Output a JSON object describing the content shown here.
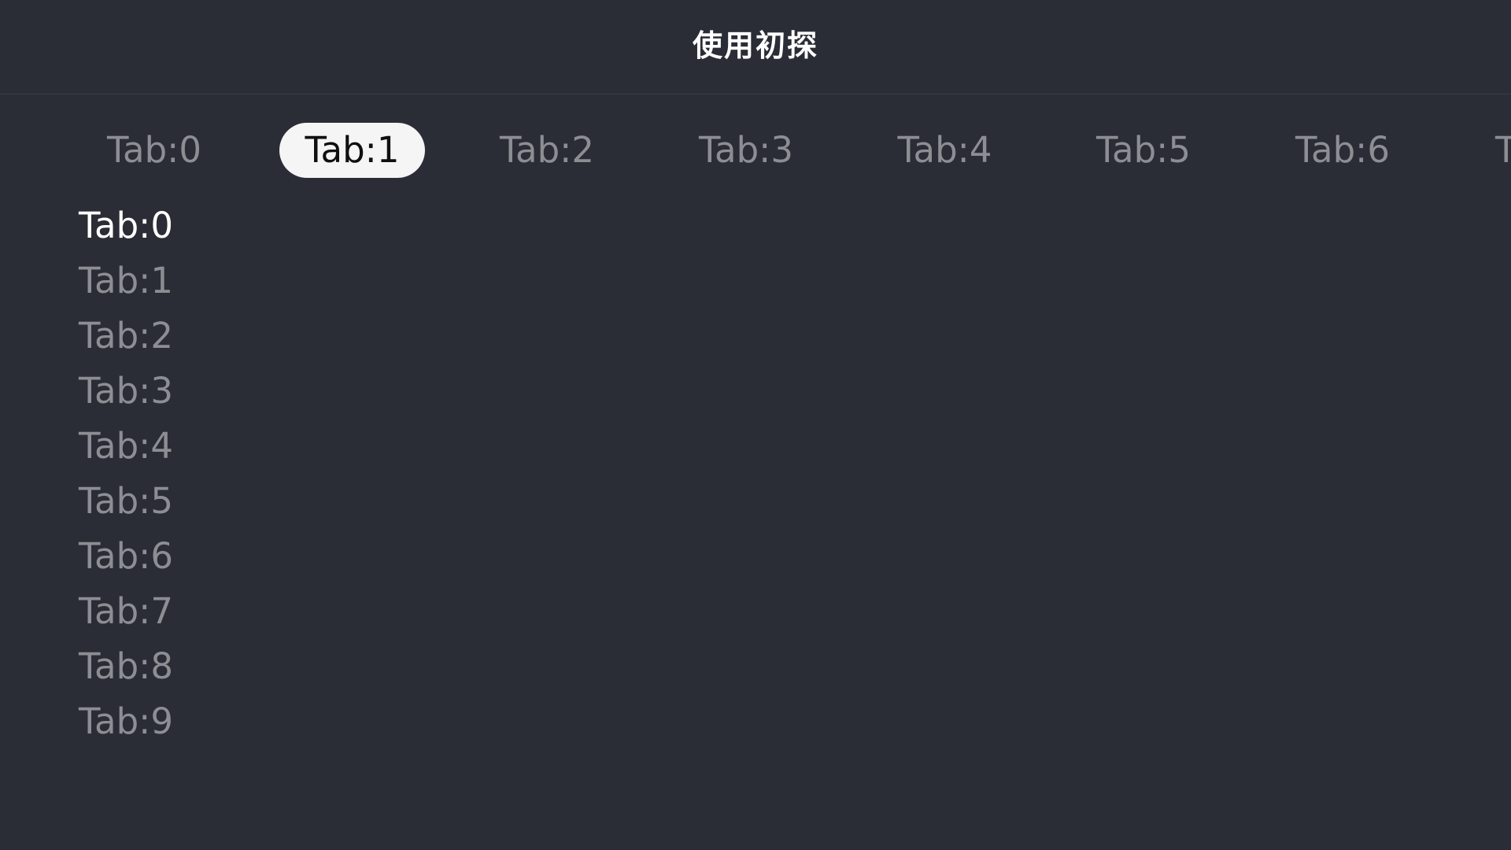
{
  "header": {
    "title": "使用初探"
  },
  "tabs": [
    {
      "label": "Tab:0",
      "selected": false
    },
    {
      "label": "Tab:1",
      "selected": true
    },
    {
      "label": "Tab:2",
      "selected": false
    },
    {
      "label": "Tab:3",
      "selected": false
    },
    {
      "label": "Tab:4",
      "selected": false
    },
    {
      "label": "Tab:5",
      "selected": false
    },
    {
      "label": "Tab:6",
      "selected": false
    },
    {
      "label": "T",
      "selected": false
    }
  ],
  "content_list": [
    {
      "label": "Tab:0",
      "active": true
    },
    {
      "label": "Tab:1",
      "active": false
    },
    {
      "label": "Tab:2",
      "active": false
    },
    {
      "label": "Tab:3",
      "active": false
    },
    {
      "label": "Tab:4",
      "active": false
    },
    {
      "label": "Tab:5",
      "active": false
    },
    {
      "label": "Tab:6",
      "active": false
    },
    {
      "label": "Tab:7",
      "active": false
    },
    {
      "label": "Tab:8",
      "active": false
    },
    {
      "label": "Tab:9",
      "active": false
    }
  ],
  "colors": {
    "background": "#2a2d35",
    "active_tab_background": "#f5f5f5",
    "inactive_text": "#8c8e93",
    "active_text": "#ffffff"
  }
}
